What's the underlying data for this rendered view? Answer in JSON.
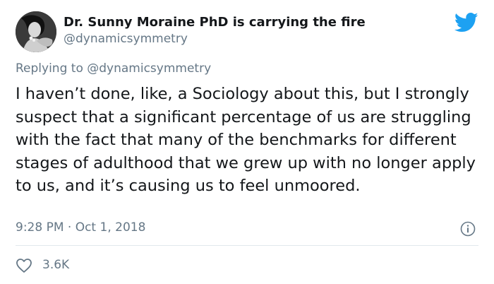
{
  "author": {
    "display_name": "Dr. Sunny Moraine PhD is carrying the fire",
    "handle": "@dynamicsymmetry"
  },
  "reply": {
    "prefix": "Replying to",
    "mention": "@dynamicsymmetry"
  },
  "tweet": {
    "text": "I haven’t done, like, a Sociology about this, but I strongly suspect that a significant percentage of us are struggling with the fact that many of the benchmarks for different stages of adulthood that we grew up with no longer apply to us, and it’s causing us to feel unmoored.",
    "timestamp": "9:28 PM · Oct 1, 2018"
  },
  "engagement": {
    "likes": "3.6K"
  },
  "colors": {
    "twitter_blue": "#1da1f2",
    "secondary_text": "#657786",
    "divider": "#e1e8ed"
  },
  "icons": {
    "brand": "twitter-bird-icon",
    "info": "info-icon",
    "like": "heart-icon"
  }
}
